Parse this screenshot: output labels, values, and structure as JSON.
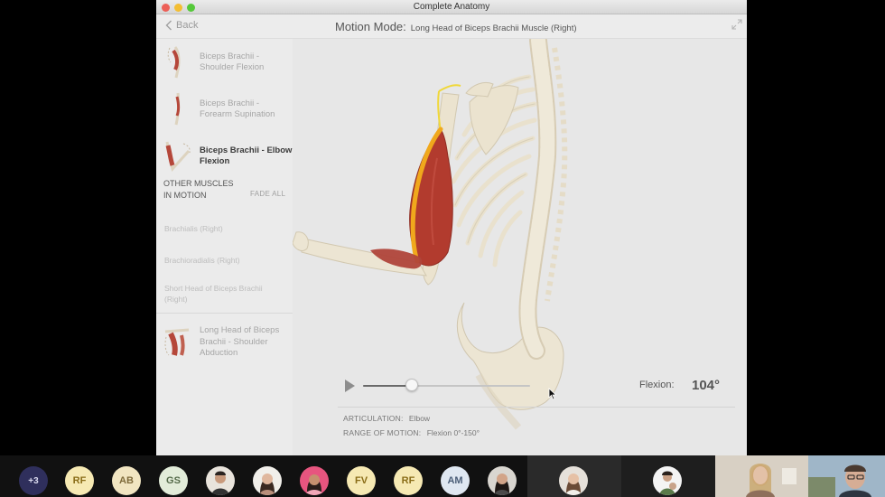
{
  "window": {
    "title": "Complete Anatomy"
  },
  "header": {
    "back_label": "Back",
    "motion_mode_label": "Motion Mode:",
    "motion_mode_value": "Long Head of Biceps Brachii Muscle (Right)"
  },
  "sidebar": {
    "items": [
      {
        "label": "Biceps Brachii - Shoulder Flexion",
        "active": false
      },
      {
        "label": "Biceps Brachii - Forearm Supination",
        "active": false
      },
      {
        "label": "Biceps Brachii - Elbow Flexion",
        "active": true
      }
    ],
    "other_heading": "OTHER MUSCLES IN MOTION",
    "fade_all_label": "FADE ALL",
    "other_muscles": [
      "Brachialis (Right)",
      "Brachioradialis (Right)",
      "Short Head of Biceps Brachii (Right)"
    ],
    "bottom_item": {
      "label": "Long Head of Biceps Brachii - Shoulder Abduction"
    }
  },
  "player": {
    "progress_fraction": 0.29,
    "flexion_label": "Flexion:",
    "flexion_value": "104°"
  },
  "info": {
    "articulation_label": "ARTICULATION:",
    "articulation_value": "Elbow",
    "range_label": "RANGE OF MOTION:",
    "range_value": "Flexion 0°-150°"
  },
  "call": {
    "participants": [
      {
        "initials": "+3",
        "kind": "overflow"
      },
      {
        "initials": "RF",
        "kind": "initials"
      },
      {
        "initials": "AB",
        "kind": "initials"
      },
      {
        "initials": "GS",
        "kind": "initials"
      },
      {
        "initials": "",
        "kind": "photo"
      },
      {
        "initials": "",
        "kind": "photo"
      },
      {
        "initials": "",
        "kind": "photo"
      },
      {
        "initials": "FV",
        "kind": "initials"
      },
      {
        "initials": "RF",
        "kind": "initials"
      },
      {
        "initials": "AM",
        "kind": "initials"
      },
      {
        "initials": "",
        "kind": "photo"
      },
      {
        "initials": "",
        "kind": "photo"
      },
      {
        "initials": "",
        "kind": "photo"
      }
    ]
  },
  "colors": {
    "muscle": "#b23b2e",
    "tendon": "#f0a81c",
    "bone": "#ebe3cf",
    "background": "#e7e7e7"
  }
}
